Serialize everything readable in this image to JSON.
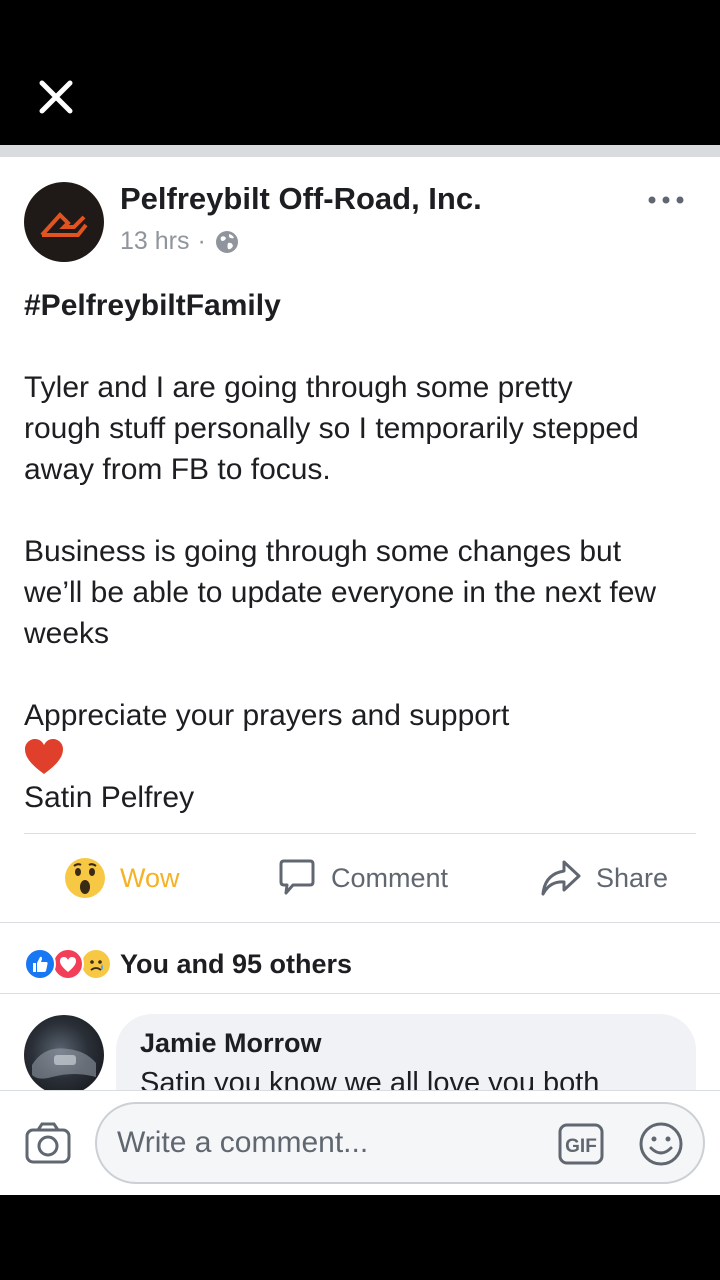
{
  "post": {
    "page_name": "Pelfreybilt Off-Road, Inc.",
    "time": "13 hrs",
    "separator": "·",
    "hashtag": "#PelfreybiltFamily",
    "paragraph1": "Tyler and I are going through some pretty\nrough stuff personally so I temporarily stepped\naway from FB to focus.",
    "paragraph2": "Business is going through some changes but\nwe’ll be able to update everyone in the next few\nweeks",
    "paragraph3": "Appreciate your prayers and support",
    "signature": "Satin Pelfrey"
  },
  "actions": {
    "wow_label": "Wow",
    "comment_label": "Comment",
    "share_label": "Share"
  },
  "reactions": {
    "summary": "You and 95 others",
    "types": [
      "like",
      "love",
      "sad"
    ]
  },
  "comment": {
    "author": "Jamie Morrow",
    "text": "Satin you know we all love you both"
  },
  "composer": {
    "placeholder": "Write a comment..."
  },
  "colors": {
    "wow_accent": "#f7b125",
    "like_blue": "#1877f2",
    "love_red": "#f33e58",
    "heart_emoji": "#e0402b"
  },
  "icons": {
    "close": "close-icon",
    "more": "more-options-icon",
    "globe": "globe-icon",
    "camera": "camera-icon",
    "gif": "gif-icon",
    "emoji": "emoji-icon"
  }
}
